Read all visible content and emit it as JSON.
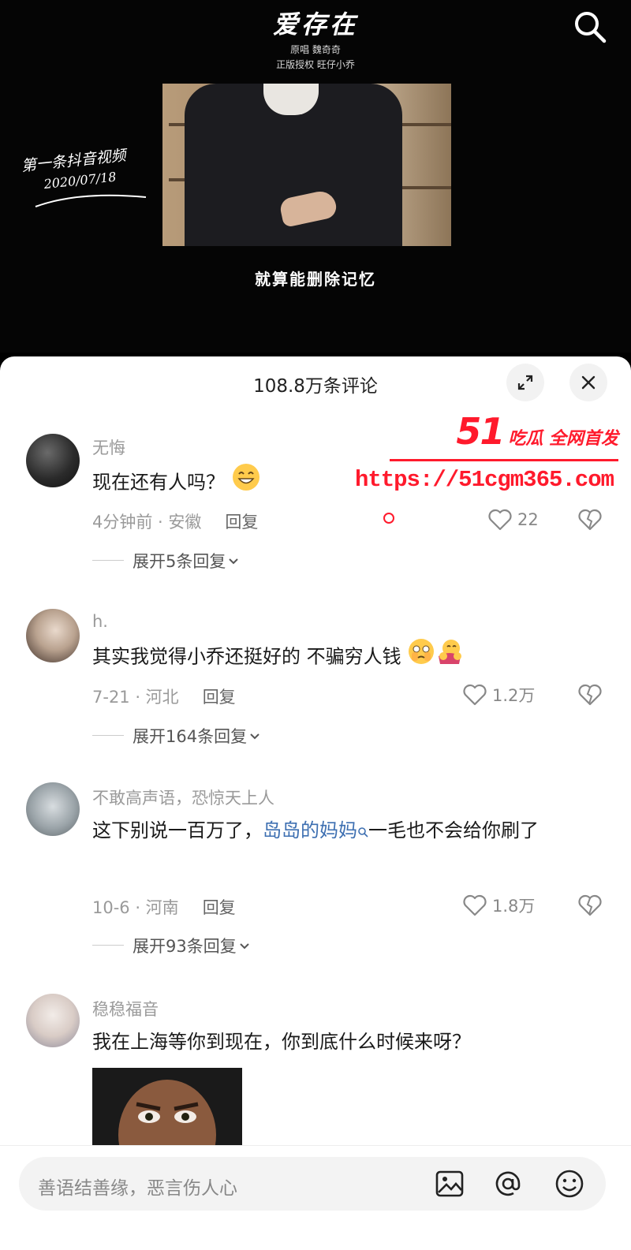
{
  "video": {
    "song_title": "爱存在",
    "original_singer": "原唱 魏奇奇",
    "license": "正版授权 旺仔小乔",
    "signature_line1": "第一条抖音视频",
    "signature_date": "2020/07/18",
    "caption": "就算能删除记忆"
  },
  "comments_panel": {
    "title": "108.8万条评论",
    "placeholder": "善语结善缘，恶言伤人心",
    "comments": [
      {
        "username": "无悔",
        "text": "现在还有人吗？",
        "meta": "4分钟前 · 安徽",
        "reply_label": "回复",
        "likes": "22",
        "expand": "展开5条回复"
      },
      {
        "username": "h.",
        "text": "其实我觉得小乔还挺好的 不骗穷人钱",
        "meta": "7-21 · 河北",
        "reply_label": "回复",
        "likes": "1.2万",
        "expand": "展开164条回复"
      },
      {
        "username": "不敢高声语，恐惊天上人",
        "text_before": "这下别说一百万了，",
        "mention": "岛岛的妈妈",
        "text_after": "一毛也不会给你刷了",
        "meta": "10-6 · 河南",
        "reply_label": "回复",
        "likes": "1.8万",
        "expand": "展开93条回复"
      },
      {
        "username": "稳稳福音",
        "text": "我在上海等你到现在，你到底什么时候来呀？"
      }
    ]
  },
  "watermark": {
    "number": "51",
    "tag": "吃瓜 全网首发",
    "url": "https://51cgm365.com"
  },
  "colors": {
    "watermark_red": "#ff1a2c",
    "mention_blue": "#3d6fb1"
  }
}
